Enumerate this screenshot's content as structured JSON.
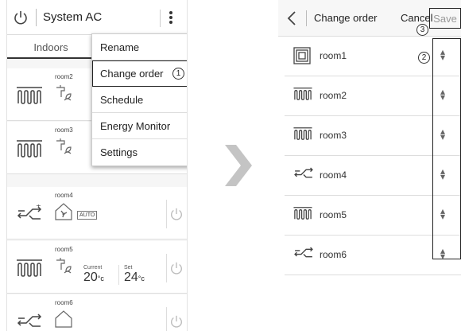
{
  "left_screen": {
    "title": "System AC",
    "tab": "Indoors",
    "menu": {
      "items": [
        "Rename",
        "Change order",
        "Schedule",
        "Energy Monitor",
        "Settings"
      ],
      "callout": "1"
    },
    "rooms": [
      {
        "name": "room2",
        "icon": "floor-heating-icon",
        "sub_icon": "faucet-icon"
      },
      {
        "name": "room3",
        "icon": "floor-heating-icon",
        "sub_icon": "faucet-icon"
      },
      {
        "name": "room4",
        "icon": "ventilation-icon",
        "sub_icon": "house-fan-icon",
        "badge": "AUTO"
      },
      {
        "name": "room5",
        "icon": "floor-heating-icon",
        "sub_icon": "faucet-icon",
        "current_label": "Current",
        "current_value": "20",
        "set_label": "Set",
        "set_value": "24",
        "unit": "°c"
      },
      {
        "name": "room6",
        "icon": "ventilation-icon",
        "sub_icon": "house-icon"
      }
    ]
  },
  "right_screen": {
    "title": "Change order",
    "cancel": "Cancel",
    "save": "Save",
    "callout_save": "3",
    "callout_handles": "2",
    "rows": [
      {
        "name": "room1",
        "icon": "square-unit-icon"
      },
      {
        "name": "room2",
        "icon": "floor-heating-icon"
      },
      {
        "name": "room3",
        "icon": "floor-heating-icon"
      },
      {
        "name": "room4",
        "icon": "ventilation-icon"
      },
      {
        "name": "room5",
        "icon": "floor-heating-icon"
      },
      {
        "name": "room6",
        "icon": "ventilation-icon"
      }
    ]
  },
  "colors": {
    "arrow": "#c4c4c4",
    "text": "#222222",
    "disabled_text": "#999999"
  }
}
